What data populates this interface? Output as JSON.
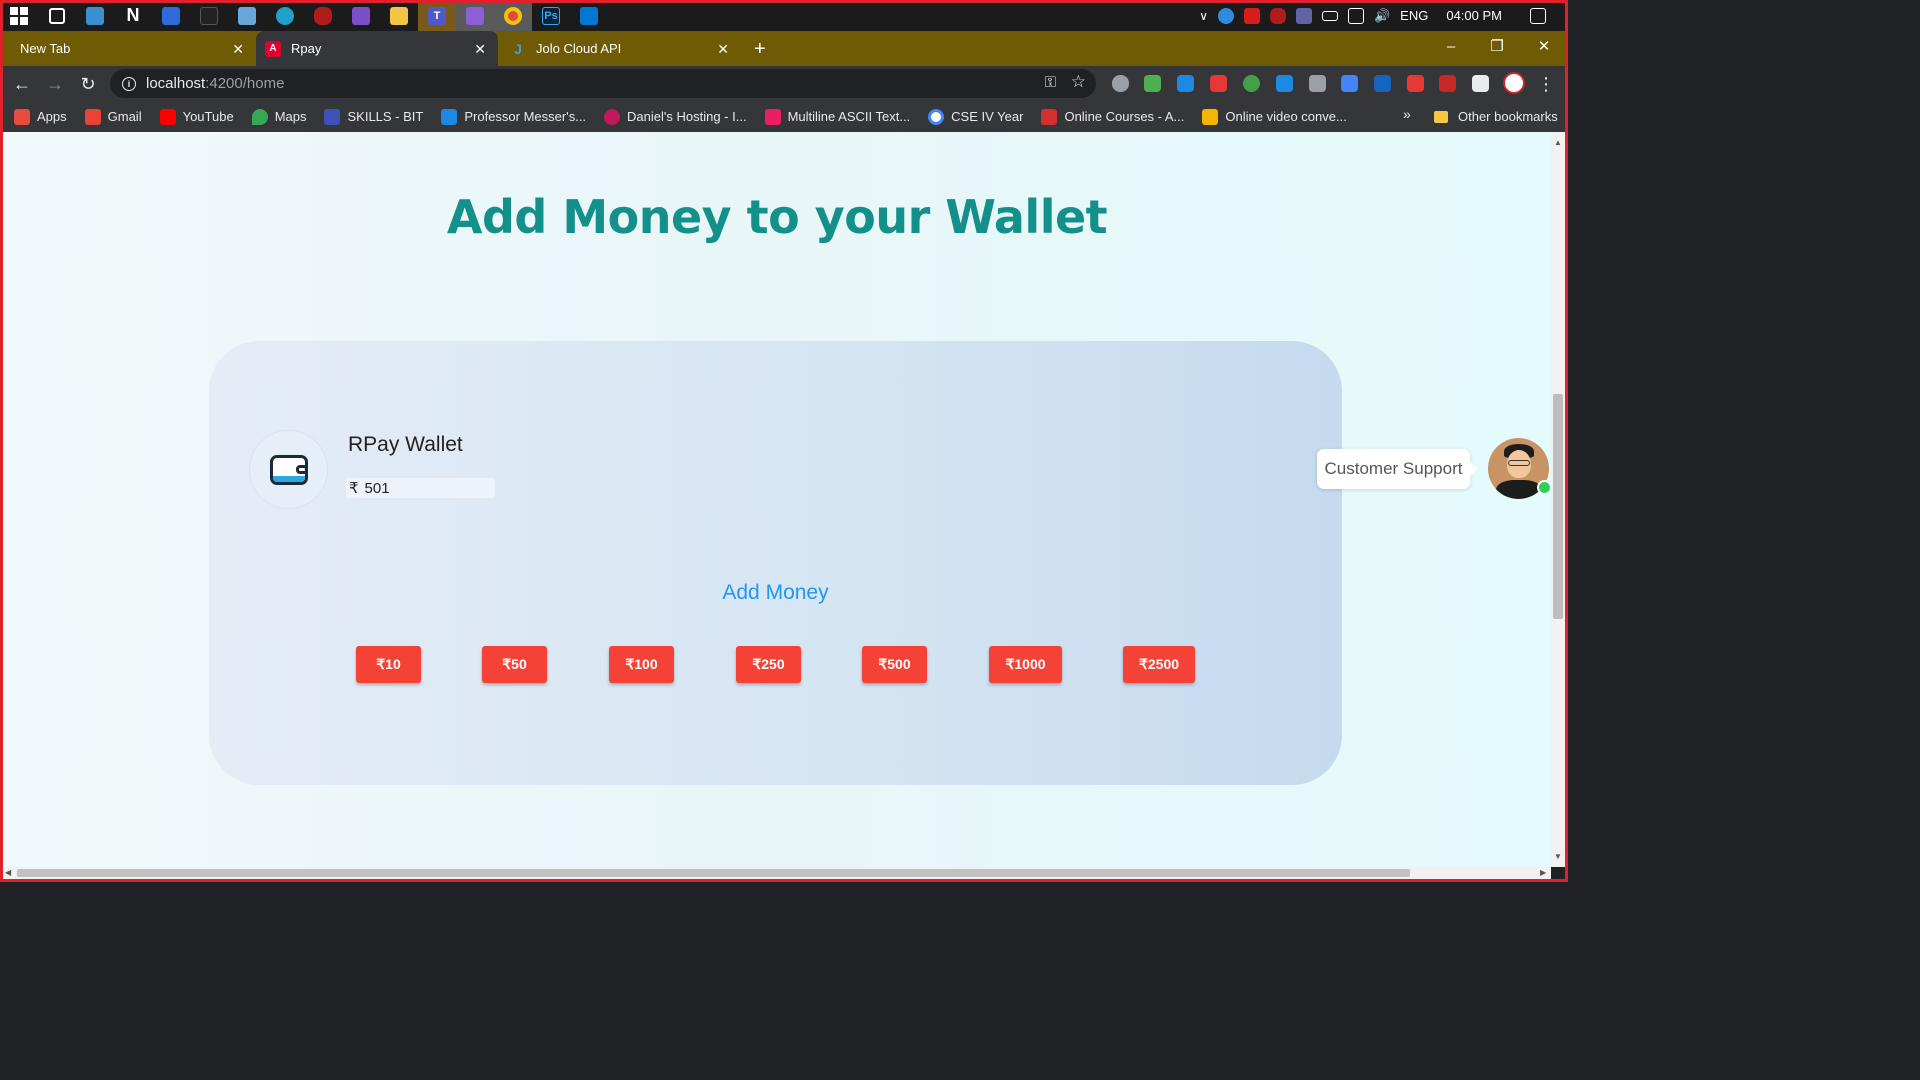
{
  "taskbar": {
    "tray": {
      "language": "ENG",
      "time": "04:00 PM"
    }
  },
  "tabs": [
    {
      "title": "New Tab"
    },
    {
      "title": "Rpay"
    },
    {
      "title": "Jolo Cloud API"
    }
  ],
  "address_bar": {
    "host": "localhost",
    "path": ":4200/home"
  },
  "bookmarks": {
    "items": [
      {
        "label": "Apps",
        "color": "#e74c3c"
      },
      {
        "label": "Gmail",
        "color": "#ea4335"
      },
      {
        "label": "YouTube",
        "color": "#ff0000"
      },
      {
        "label": "Maps",
        "color": "#34a853"
      },
      {
        "label": "SKILLS - BIT",
        "color": "#3f51b5"
      },
      {
        "label": "Professor Messer's...",
        "color": "#1e88e5"
      },
      {
        "label": "Daniel's Hosting - I...",
        "color": "#c2185b"
      },
      {
        "label": "Multiline ASCII Text...",
        "color": "#e91e63"
      },
      {
        "label": "CSE IV Year",
        "color": "#4285f4"
      },
      {
        "label": "Online Courses - A...",
        "color": "#d32f2f"
      },
      {
        "label": "Online video conve...",
        "color": "#f4b400"
      }
    ],
    "more": "»",
    "other": "Other bookmarks"
  },
  "page": {
    "heading": "Add Money to your Wallet",
    "wallet": {
      "title": "RPay Wallet",
      "currency_symbol": "₹",
      "balance": "501"
    },
    "add_money_label": "Add Money",
    "amounts": [
      "₹10",
      "₹50",
      "₹100",
      "₹250",
      "₹500",
      "₹1000",
      "₹2500"
    ],
    "support": {
      "label": "Customer Support"
    }
  }
}
